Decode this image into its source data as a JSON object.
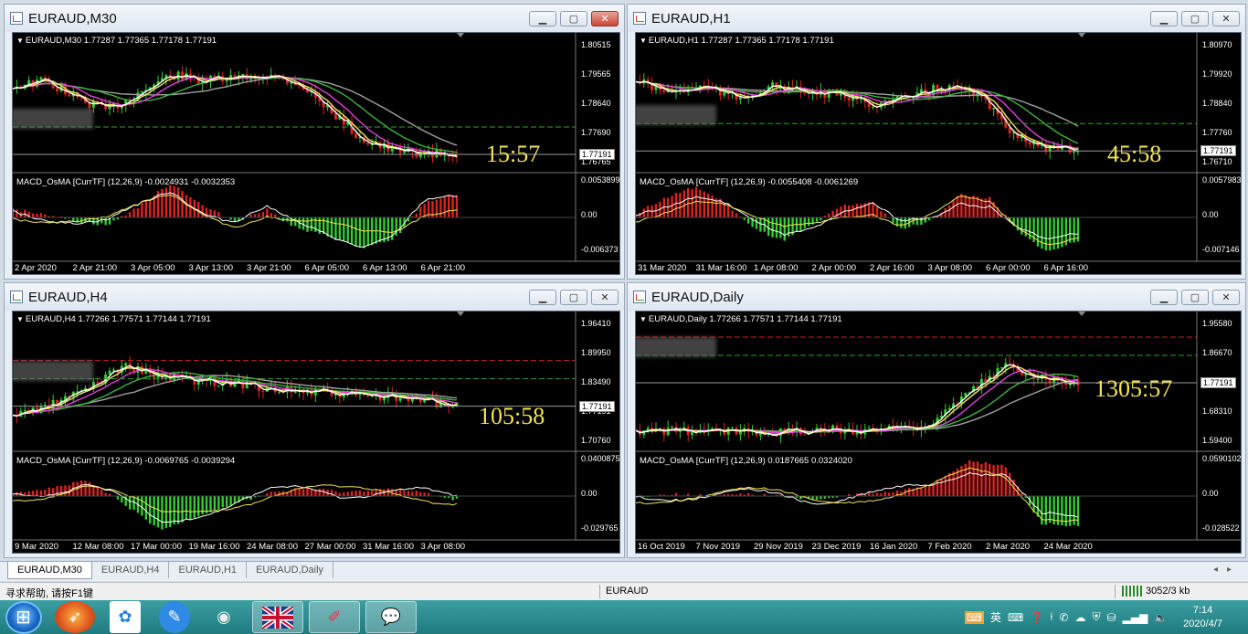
{
  "windows": [
    {
      "title": "EURAUD,M30",
      "ohlc": "EURAUD,M30  1.77287 1.77365 1.77178 1.77191",
      "timer": "15:57",
      "macd": "MACD_OsMA [CurrTF] (12,26,9) -0.0024931 -0.0032353",
      "price_ticks": [
        "1.80515",
        "1.79565",
        "1.78640",
        "1.77690",
        "1.76765"
      ],
      "price_current": "1.77191",
      "macd_ticks": [
        "0.0053899",
        "0.00",
        "-0.006373"
      ],
      "x_labels": [
        "2 Apr 2020",
        "2 Apr 21:00",
        "3 Apr 05:00",
        "3 Apr 13:00",
        "3 Apr 21:00",
        "6 Apr 05:00",
        "6 Apr 13:00",
        "6 Apr 21:00"
      ]
    },
    {
      "title": "EURAUD,H1",
      "ohlc": "EURAUD,H1  1.77287 1.77365 1.77178 1.77191",
      "timer": "45:58",
      "macd": "MACD_OsMA [CurrTF] (12,26,9) -0.0055408 -0.0061269",
      "price_ticks": [
        "1.80970",
        "1.79920",
        "1.78840",
        "1.77760",
        "1.76710"
      ],
      "price_current": "1.77191",
      "macd_ticks": [
        "0.0057983",
        "0.00",
        "-0.007146"
      ],
      "x_labels": [
        "31 Mar 2020",
        "31 Mar 16:00",
        "1 Apr 08:00",
        "2 Apr 00:00",
        "2 Apr 16:00",
        "3 Apr 08:00",
        "6 Apr 00:00",
        "6 Apr 16:00"
      ]
    },
    {
      "title": "EURAUD,H4",
      "ohlc": "EURAUD,H4  1.77266 1.77571 1.77144 1.77191",
      "timer": "105:58",
      "macd": "MACD_OsMA [CurrTF] (12,26,9) -0.0069765 -0.0039294",
      "price_ticks": [
        "1.96410",
        "1.89950",
        "1.83490",
        "1.77191",
        "1.70760"
      ],
      "price_current": "1.77191",
      "macd_ticks": [
        "0.0400875",
        "0.00",
        "-0.029765"
      ],
      "x_labels": [
        "9 Mar 2020",
        "12 Mar 08:00",
        "17 Mar 00:00",
        "19 Mar 16:00",
        "24 Mar 08:00",
        "27 Mar 00:00",
        "31 Mar 16:00",
        "3 Apr 08:00"
      ]
    },
    {
      "title": "EURAUD,Daily",
      "ohlc": "EURAUD,Daily  1.77266 1.77571 1.77144 1.77191",
      "timer": "1305:57",
      "macd": "MACD_OsMA [CurrTF] (12,26,9) 0.0187665 0.0324020",
      "price_ticks": [
        "1.95580",
        "1.86670",
        "1.77191",
        "1.68310",
        "1.59400"
      ],
      "price_current": "1.77191",
      "macd_ticks": [
        "0.0590102",
        "0.00",
        "-0.028522"
      ],
      "x_labels": [
        "16 Oct 2019",
        "7 Nov 2019",
        "29 Nov 2019",
        "23 Dec 2019",
        "16 Jan 2020",
        "7 Feb 2020",
        "2 Mar 2020",
        "24 Mar 2020"
      ]
    }
  ],
  "tabs": [
    "EURAUD,M30",
    "EURAUD,H4",
    "EURAUD,H1",
    "EURAUD,Daily"
  ],
  "status": {
    "help": "寻求帮助, 请按F1键",
    "symbol": "EURAUD",
    "traffic": "3052/3 kb"
  },
  "tray": {
    "ime": "英",
    "time": "7:14",
    "date": "2020/4/7"
  },
  "taskbar_apps": [
    "folder-app-icon",
    "cloud-app-icon",
    "pen-app-icon",
    "camera-app-icon",
    "uk-flag-app-icon",
    "paint-app-icon",
    "wechat-app-icon"
  ],
  "colors": {
    "ma_white": "#ffffff",
    "ma_yellow": "#f2e35a",
    "ma_magenta": "#e040e0",
    "ma_green": "#3cb43c",
    "ma_gray": "#a0a0a0",
    "bull": "#33cc33",
    "bear": "#dd2222",
    "timer": "#f2e35a"
  }
}
